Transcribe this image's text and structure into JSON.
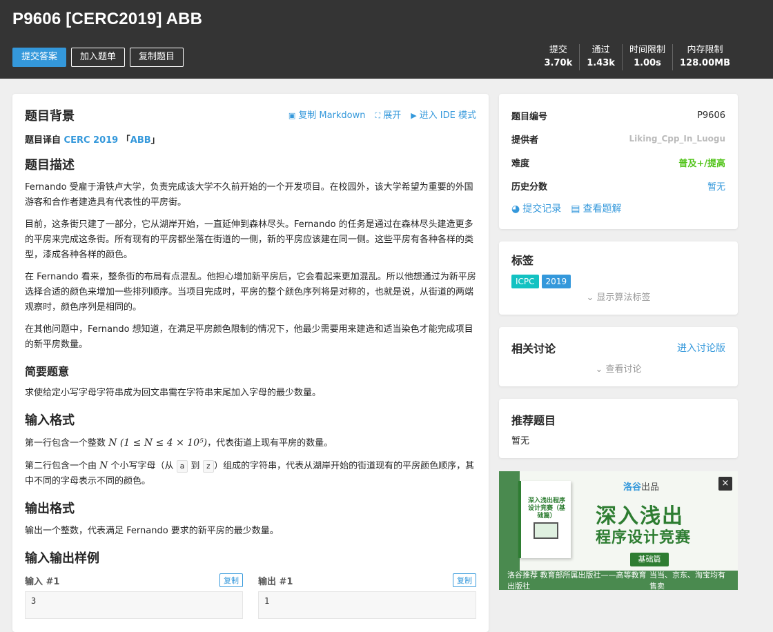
{
  "header": {
    "title": "P9606 [CERC2019] ABB",
    "actions": {
      "submit": "提交答案",
      "add_list": "加入题单",
      "copy": "复制题目"
    },
    "stats": [
      {
        "label": "提交",
        "value": "3.70k"
      },
      {
        "label": "通过",
        "value": "1.43k"
      },
      {
        "label": "时间限制",
        "value": "1.00s"
      },
      {
        "label": "内存限制",
        "value": "128.00MB"
      }
    ]
  },
  "main": {
    "background_title": "题目背景",
    "toolbar": {
      "copy_md": "复制 Markdown",
      "expand": "展开",
      "ide": "进入 IDE 模式"
    },
    "source_prefix": "题目译自 ",
    "source_contest": "CERC 2019",
    "source_open": "「",
    "source_problem": "ABB",
    "source_close": "」",
    "desc_title": "题目描述",
    "desc_p1": "Fernando 受雇于滑铁卢大学，负责完成该大学不久前开始的一个开发项目。在校园外，该大学希望为重要的外国游客和合作者建造具有代表性的平房街。",
    "desc_p2": "目前，这条街只建了一部分，它从湖岸开始，一直延伸到森林尽头。Fernando 的任务是通过在森林尽头建造更多的平房来完成这条街。所有现有的平房都坐落在街道的一侧，新的平房应该建在同一侧。这些平房有各种各样的类型，漆成各种各样的颜色。",
    "desc_p3": "在 Fernando 看来，整条街的布局有点混乱。他担心增加新平房后，它会看起来更加混乱。所以他想通过为新平房选择合适的颜色来增加一些排列顺序。当项目完成时，平房的整个颜色序列将是对称的，也就是说，从街道的两端观察时，颜色序列是相同的。",
    "desc_p4": "在其他问题中，Fernando 想知道，在满足平房颜色限制的情况下，他最少需要用来建造和适当染色才能完成项目的新平房数量。",
    "brief_title": "简要题意",
    "brief_p": "求使给定小写字母字符串成为回文串需在字符串末尾加入字母的最少数量。",
    "input_title": "输入格式",
    "input_p1_a": "第一行包含一个整数 ",
    "input_p1_math": "N (1 ≤ N ≤ 4 × 10⁵)",
    "input_p1_b": "，代表街道上现有平房的数量。",
    "input_p2_a": "第二行包含一个由 ",
    "input_p2_n": "N",
    "input_p2_b": " 个小写字母（从 ",
    "input_p2_from": "a",
    "input_p2_c": " 到 ",
    "input_p2_to": "z",
    "input_p2_d": "）组成的字符串，代表从湖岸开始的街道现有的平房颜色顺序，其中不同的字母表示不同的颜色。",
    "output_title": "输出格式",
    "output_p": "输出一个整数，代表满足 Fernando 要求的新平房的最少数量。",
    "samples_title": "输入输出样例",
    "sample_in_label": "输入 #1",
    "sample_out_label": "输出 #1",
    "copy_label": "复制",
    "sample_in": "3",
    "sample_out": "1"
  },
  "sidebar": {
    "info": [
      {
        "key": "题目编号",
        "value": "P9606"
      },
      {
        "key": "提供者",
        "value": "Liking_Cpp_In_Luogu"
      },
      {
        "key": "难度",
        "value": "普及+/提高"
      },
      {
        "key": "历史分数",
        "value": "暂无"
      }
    ],
    "records_link": "提交记录",
    "solutions_link": "查看题解",
    "tags_title": "标签",
    "tags": [
      "ICPC",
      "2019"
    ],
    "show_tags": "显示算法标签",
    "discuss_title": "相关讨论",
    "discuss_link": "进入讨论版",
    "view_discuss": "查看讨论",
    "recommend_title": "推荐题目",
    "recommend_empty": "暂无"
  },
  "ad": {
    "book_title": "深入浅出程序设计竞赛（基础篇）",
    "logo": "洛谷",
    "logo_suffix": "出品",
    "headline1": "深入浅出",
    "headline2": "程序设计竞赛",
    "pill": "基础篇",
    "close": "×",
    "foot_left": "洛谷推荐  教育部所属出版社——高等教育出版社",
    "foot_right": "当当、京东、淘宝均有售卖"
  },
  "colors": {
    "accent": "#3498db",
    "header_bg": "#343434",
    "difficulty": "#52c41a",
    "tag_icpc": "#13c2c2",
    "tag_year": "#3498db",
    "ad_green": "#2e7d32"
  }
}
